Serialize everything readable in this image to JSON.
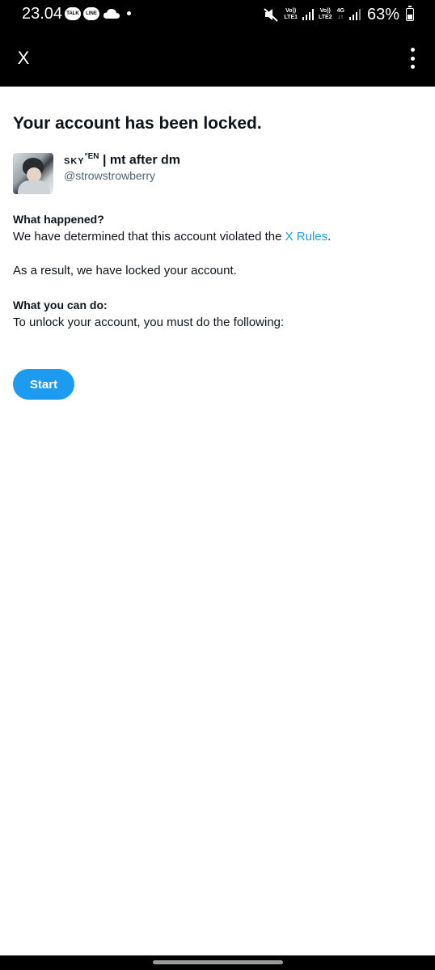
{
  "status_bar": {
    "time": "23.04",
    "notification_badges": [
      "TALK",
      "LINE"
    ],
    "sim1": {
      "line1": "Vo))",
      "line2": "LTE1"
    },
    "sim2": {
      "line1": "Vo))",
      "line2": "LTE2"
    },
    "data_type": {
      "line1": "4G",
      "line2": "↓↑"
    },
    "battery_percent": "63%",
    "battery_level": 0.63
  },
  "app_bar": {
    "close_label": "X"
  },
  "page": {
    "title": "Your account has been locked.",
    "account": {
      "display_name_prefix": "SKY",
      "display_name_superscript": "°EN",
      "display_name_suffix": " | mt after dm",
      "handle": "@strowstrowberry"
    },
    "what_happened": {
      "heading": "What happened?",
      "text_before_link": "We have determined that this account violated the ",
      "link_text": "X Rules",
      "text_after_link": "."
    },
    "result_text": "As a result, we have locked your account.",
    "what_you_can_do": {
      "heading": "What you can do:",
      "text": "To unlock your account, you must do the following:"
    },
    "start_button": "Start"
  },
  "colors": {
    "accent": "#1d9bf0",
    "text": "#0f1419",
    "secondary_text": "#536471"
  }
}
